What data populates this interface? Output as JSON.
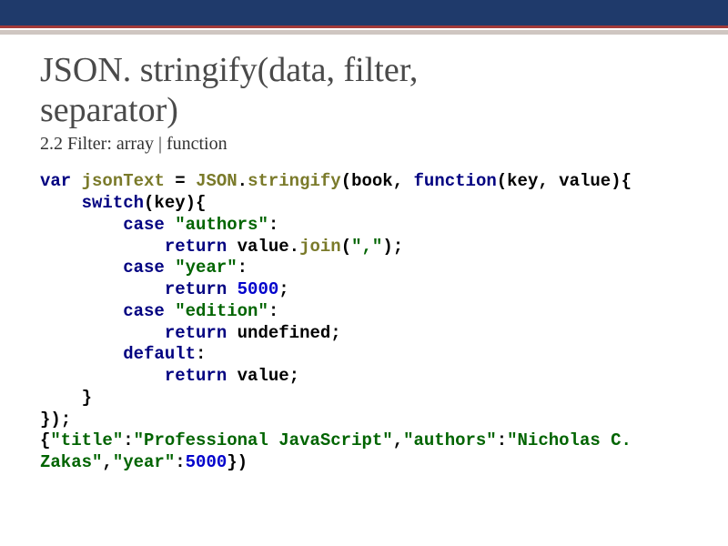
{
  "header": {
    "title_line1": "JSON. stringify(data, filter,",
    "title_line2": "separator)",
    "subtitle": "2.2 Filter: array | function"
  },
  "code": {
    "kw_var": "var",
    "id_jsonText": "jsonText",
    "eq": " = ",
    "id_JSON": "JSON",
    "dot1": ".",
    "id_stringify": "stringify",
    "open_args": "(book, ",
    "kw_function": "function",
    "fn_params": "(key, value){",
    "indent1": "    ",
    "kw_switch": "switch",
    "switch_cond": "(key){",
    "indent2": "        ",
    "kw_case1": "case",
    "sp": " ",
    "str_authors": "\"authors\"",
    "colon": ":",
    "indent3": "            ",
    "kw_return1": "return",
    "ret1_a": " value.",
    "id_join": "join",
    "ret1_b": "(",
    "str_comma": "\",\"",
    "ret1_c": ");",
    "kw_case2": "case",
    "str_year": "\"year\"",
    "kw_return2": "return",
    "num_5000": "5000",
    "semi": ";",
    "kw_case3": "case",
    "str_edition": "\"edition\"",
    "kw_return3": "return",
    "ret3_val": " undefined;",
    "kw_default": "default",
    "kw_return4": "return",
    "ret4_val": " value;",
    "close_brace1": "    }",
    "close_all": "});",
    "out_open": "{",
    "out_title_k": "\"title\"",
    "out_title_v": "\"Professional JavaScript\"",
    "out_authors_k": "\"authors\"",
    "out_authors_v": "\"Nicholas C. ",
    "out_zakas": "Zakas\"",
    "out_year_k": "\"year\"",
    "out_close": "})"
  }
}
